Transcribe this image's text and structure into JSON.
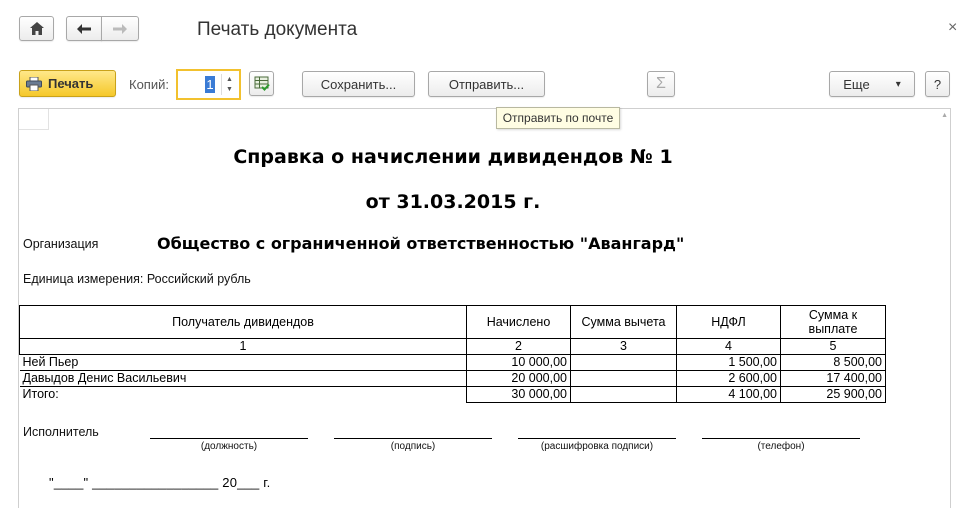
{
  "window": {
    "title": "Печать документа",
    "close_glyph": "×"
  },
  "nav": {
    "home_icon": "home-icon",
    "back_glyph": "🡐",
    "forward_glyph": "🡒"
  },
  "toolbar": {
    "print_label": "Печать",
    "copies_label": "Копий:",
    "copies_value": "1",
    "save_label": "Сохранить...",
    "send_label": "Отправить...",
    "sum_glyph": "Σ",
    "more_label": "Еще",
    "more_arrow": "▾",
    "help_label": "?",
    "spin_up": "▲",
    "spin_down": "▼"
  },
  "tooltip": {
    "text": "Отправить по почте"
  },
  "document": {
    "title_line1": "Справка о начислении дивидендов № 1",
    "title_line2": "от 31.03.2015 г.",
    "org_label": "Организация",
    "org_value": "Общество с ограниченной ответственностью \"Авангард\"",
    "unit_text": "Единица измерения: Российский рубль",
    "table": {
      "headers": [
        "Получатель дивидендов",
        "Начислено",
        "Сумма вычета",
        "НДФЛ",
        "Сумма к выплате"
      ],
      "col_numbers": [
        "1",
        "2",
        "3",
        "4",
        "5"
      ],
      "rows": [
        [
          "Ней Пьер",
          "10 000,00",
          "",
          "1 500,00",
          "8 500,00"
        ],
        [
          "Давыдов Денис Васильевич",
          "20 000,00",
          "",
          "2 600,00",
          "17 400,00"
        ]
      ],
      "total": [
        "Итого:",
        "30 000,00",
        "",
        "4 100,00",
        "25 900,00"
      ]
    },
    "executor_label": "Исполнитель",
    "sign_captions": [
      "(должность)",
      "(подпись)",
      "(расшифровка подписи)",
      "(телефон)"
    ],
    "date_line": "\"____\" _________________ 20___ г."
  }
}
